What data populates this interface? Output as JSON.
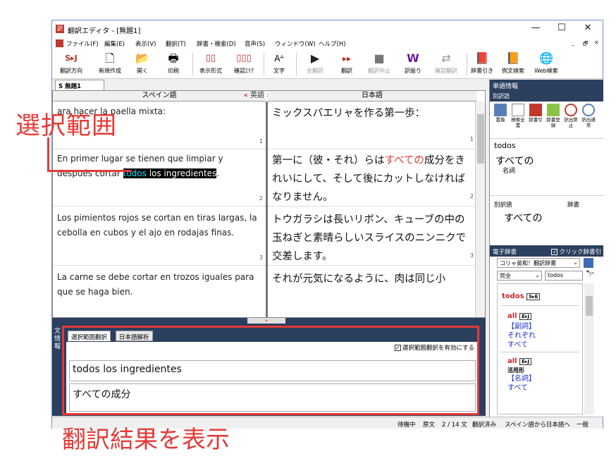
{
  "window": {
    "title": "翻訳エディタ - [無題1]",
    "controls": [
      "—",
      "☐",
      "✕"
    ],
    "mdi_controls": [
      "_",
      "🗗",
      "✕"
    ]
  },
  "menu": [
    "ファイル(F)",
    "編集(E)",
    "表示(V)",
    "翻訳(T)",
    "辞書・検索(D)",
    "音声(S)",
    "ウィンドウ(W)",
    "ヘルプ(H)"
  ],
  "toolbar": [
    {
      "label": "翻訳方向",
      "icon": "S▸J"
    },
    {
      "label": "新規作成",
      "icon": "🗋"
    },
    {
      "label": "開く",
      "icon": "📂"
    },
    {
      "label": "印刷",
      "icon": "🖶"
    },
    {
      "label": "表示形式",
      "icon": "▯▯"
    },
    {
      "label": "確認ｴﾘｱ",
      "icon": "▯▯▯"
    },
    {
      "label": "文字",
      "icon": "Aᴬ"
    },
    {
      "label": "全翻訳",
      "icon": "▶"
    },
    {
      "label": "翻訳",
      "icon": "▸▸"
    },
    {
      "label": "翻訳中止",
      "icon": "■"
    },
    {
      "label": "訳振り",
      "icon": "W"
    },
    {
      "label": "確認翻訳",
      "icon": "⇄"
    },
    {
      "label": "辞書引き",
      "icon": "📕"
    },
    {
      "label": "例文検索",
      "icon": "📙"
    },
    {
      "label": "Web検索",
      "icon": "🌐"
    }
  ],
  "doc_tab": "S 無題1",
  "editor": {
    "headers": {
      "source": "スペイン語",
      "middle": "英語",
      "target": "日本語"
    },
    "segments": [
      {
        "num": "",
        "source": "ara hacer la paella mixta:",
        "target": "ミックスパエリャを作る第一歩："
      },
      {
        "num": "1",
        "source_1": "En primer lugar se tienen que limpiar y",
        "source_2a": "después cortar ",
        "source_sel1": "todos",
        "source_sel2": " los ingredientes",
        "source_2b": ".",
        "target_1": "第一に（彼・それ）らは",
        "target_red": "すべての",
        "target_2": "成分をきれいにして、そして後にカットしなければなりません。"
      },
      {
        "num": "2",
        "source": "Los pimientos rojos se cortan en tiras largas, la cebolla en cubos y el ajo en rodajas finas.",
        "target": "トウガラシは長いリボン、キューブの中の玉ねぎと素晴らしいスライスのニンニクで交差します。"
      },
      {
        "num": "3",
        "source": "La carne se debe cortar en trozos  iguales para que se haga bien.",
        "target": "それが元気になるように、肉は同じ小"
      }
    ]
  },
  "bottom": {
    "side_label": "文情報",
    "tabs": [
      "選択範囲翻訳",
      "日本語解析"
    ],
    "checkbox_label": "選択範囲翻訳を有効にする",
    "source_text": "todos los ingredientes",
    "target_text": "すべての成分"
  },
  "word_info": {
    "header": "単語情報",
    "sub": "別訳語",
    "tools": [
      "置換",
      "検索全置",
      "辞書引",
      "辞書登録",
      "訳出禁止",
      "訳出通常"
    ],
    "word": "todos",
    "translation": "すべての",
    "pos": "名詞",
    "alt_header": "別訳語",
    "dict_header": "辞書",
    "alt_value": "すべての"
  },
  "edict": {
    "header": "電子辞書",
    "click_label": "クリック辞書引",
    "dict_select": "コリャ英和！翻訳辞書",
    "match_select": "完全",
    "search_value": "todos",
    "entries": [
      {
        "head": "todos",
        "tag": "S▸E"
      },
      {
        "head": "all",
        "tag": "E▸J",
        "pos": "【副詞】",
        "def1": "それぞれ",
        "def2": "すべて"
      },
      {
        "head": "all",
        "tag": "E▸J",
        "pos2": "活用形",
        "pos": "【名詞】",
        "def1": "すべて"
      }
    ]
  },
  "status": [
    "待機中",
    "原文",
    "2 / 14 文",
    "翻訳済み",
    "スペイン語から日本語へ",
    "一般"
  ],
  "annotations": {
    "selection": "選択範囲",
    "result": "翻訳結果を表示"
  },
  "colors": {
    "accent_red": "#e53935",
    "panel_navy": "#2b3f5f"
  }
}
